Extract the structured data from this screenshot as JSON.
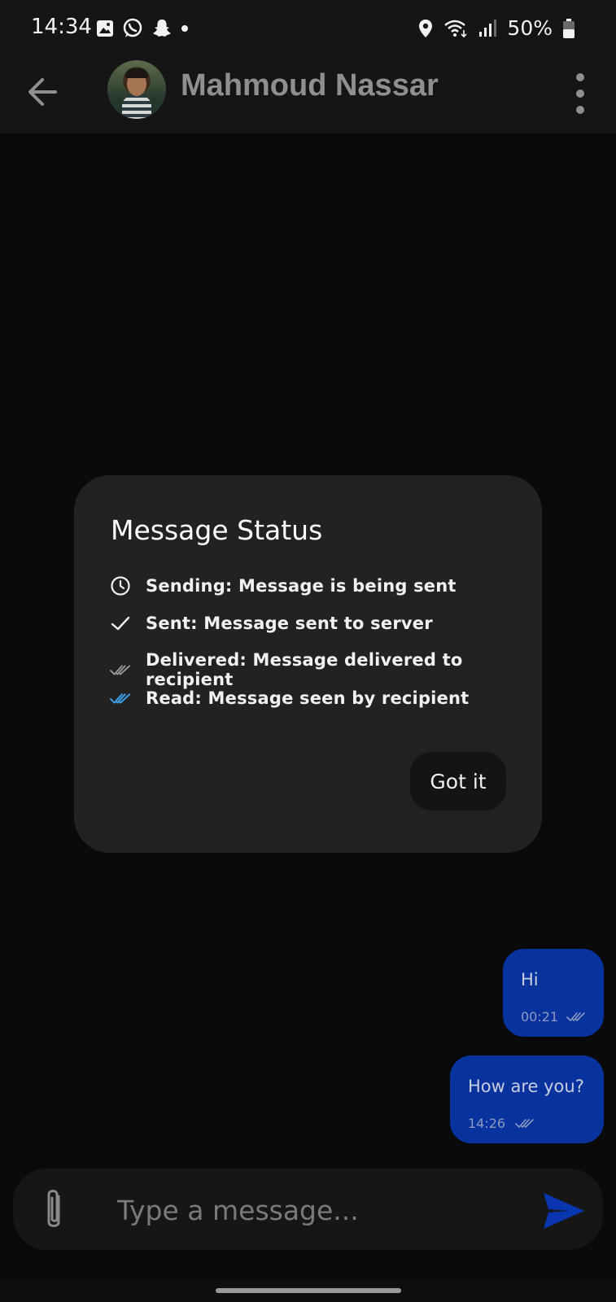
{
  "status_bar": {
    "time": "14:34",
    "battery": "50%",
    "left_icons": [
      "gallery-icon",
      "whatsapp-icon",
      "snapchat-icon",
      "dot-icon"
    ],
    "right_icons": [
      "location-icon",
      "wifi-icon",
      "signal-icon",
      "battery-icon"
    ]
  },
  "header": {
    "back_icon": "arrow-left-icon",
    "contact_name": "Mahmoud Nassar",
    "menu_icon": "more-vertical-icon"
  },
  "dialog": {
    "title": "Message Status",
    "items": [
      {
        "icon": "clock-icon",
        "label": "Sending: Message is being sent"
      },
      {
        "icon": "check-icon",
        "label": "Sent: Message sent to server"
      },
      {
        "icon": "double-check-icon",
        "label": "Delivered: Message delivered to recipient"
      },
      {
        "icon": "double-check-blue-icon",
        "label": "Read: Message seen by recipient"
      }
    ],
    "button_label": "Got it"
  },
  "messages": [
    {
      "text": "Hi",
      "time": "00:21",
      "status": "delivered"
    },
    {
      "text": "How are you?",
      "time": "14:26",
      "status": "delivered"
    }
  ],
  "composer": {
    "placeholder": "Type a message...",
    "attach_icon": "paperclip-icon",
    "send_icon": "send-icon"
  },
  "colors": {
    "background": "#0a0a0a",
    "dialog": "#222222",
    "bubble": "#08329e",
    "send": "#0a35b0",
    "read_check": "#3aa0e8"
  }
}
